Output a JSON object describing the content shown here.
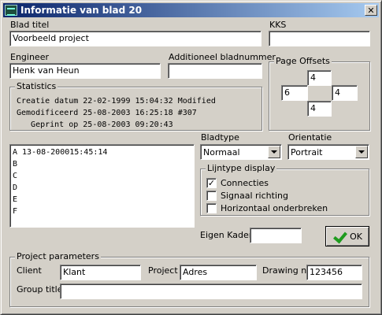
{
  "window": {
    "title": "Informatie van blad 20",
    "close_label": "✕"
  },
  "sheet": {
    "title_label": "Blad titel",
    "title_value": "Voorbeeld project",
    "kks_label": "KKS",
    "kks_value": "",
    "engineer_label": "Engineer",
    "engineer_value": "Henk van Heun",
    "extra_label": "Additioneel bladnummer",
    "extra_value": ""
  },
  "page_offsets": {
    "title": "Page Offsets",
    "top": "4",
    "left": "6",
    "right": "4",
    "bottom": "4"
  },
  "statistics": {
    "title": "Statistics",
    "lines": [
      "Creatie datum 22-02-1999 15:04:32 Modified",
      "Gemodificeerd 25-08-2003 16:25:18 #307",
      "   Geprint op 25-08-2003 09:20:43"
    ]
  },
  "revisions": [
    "A 13-08-200015:45:14",
    "B",
    "C",
    "D",
    "E",
    "F"
  ],
  "bladtype": {
    "label": "Bladtype",
    "value": "Normaal"
  },
  "orientatie": {
    "label": "Orientatie",
    "value": "Portrait"
  },
  "lijntype": {
    "title": "Lijntype display",
    "options": [
      {
        "label": "Connecties",
        "checked": true
      },
      {
        "label": "Signaal richting",
        "checked": false
      },
      {
        "label": "Horizontaal onderbreken",
        "checked": false
      }
    ]
  },
  "eigen_kader": {
    "label": "Eigen Kader",
    "value": ""
  },
  "ok_button": {
    "label": "OK"
  },
  "project": {
    "title": "Project parameters",
    "client_label": "Client",
    "client_value": "Klant",
    "project_label": "Project",
    "project_value": "Adres",
    "drawing_label": "Drawing nr.",
    "drawing_value": "123456",
    "group_label": "Group title",
    "group_value": ""
  }
}
